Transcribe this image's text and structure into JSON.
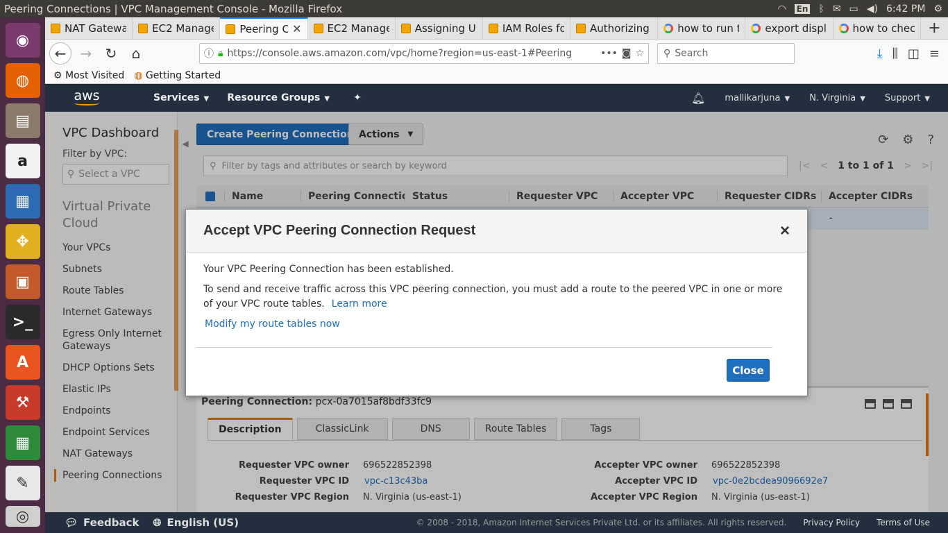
{
  "os": {
    "window_title": "Peering Connections | VPC Management Console - Mozilla Firefox",
    "keyboard": "En",
    "clock": "6:42 PM"
  },
  "browser": {
    "tabs": [
      {
        "label": "NAT Gatewa",
        "icon": "aws-icon"
      },
      {
        "label": "EC2 Manage",
        "icon": "aws-icon"
      },
      {
        "label": "Peering C",
        "icon": "aws-icon",
        "active": true
      },
      {
        "label": "EC2 Manage",
        "icon": "aws-icon"
      },
      {
        "label": "Assigning U",
        "icon": "aws-icon"
      },
      {
        "label": "IAM Roles fo",
        "icon": "aws-icon"
      },
      {
        "label": "Authorizing",
        "icon": "aws-icon"
      },
      {
        "label": "how to run t",
        "icon": "google-icon"
      },
      {
        "label": "export displ",
        "icon": "google-icon"
      },
      {
        "label": "how to chec",
        "icon": "google-icon"
      }
    ],
    "url": "https://console.aws.amazon.com/vpc/home?region=us-east-1#Peering",
    "search_placeholder": "Search",
    "bookmarks": [
      "Most Visited",
      "Getting Started"
    ]
  },
  "aws_nav": {
    "logo": "aws",
    "services": "Services",
    "resource_groups": "Resource Groups",
    "user": "mallikarjuna",
    "region": "N. Virginia",
    "support": "Support"
  },
  "sidebar": {
    "dashboard": "VPC Dashboard",
    "filter_label": "Filter by VPC:",
    "filter_placeholder": "Select a VPC",
    "section": "Virtual Private Cloud",
    "items": [
      "Your VPCs",
      "Subnets",
      "Route Tables",
      "Internet Gateways",
      "Egress Only Internet Gateways",
      "DHCP Options Sets",
      "Elastic IPs",
      "Endpoints",
      "Endpoint Services",
      "NAT Gateways",
      "Peering Connections"
    ]
  },
  "toolbar": {
    "create": "Create Peering Connection",
    "actions": "Actions",
    "filter_placeholder": "Filter by tags and attributes or search by keyword",
    "pager": "1 to 1 of 1"
  },
  "grid": {
    "columns": [
      "Name",
      "Peering Connectic",
      "Status",
      "Requester VPC",
      "Accepter VPC",
      "Requester CIDRs",
      "Accepter CIDRs"
    ],
    "row_accepter_cidrs": "-"
  },
  "detail": {
    "label": "Peering Connection:",
    "id": "pcx-0a7015af8bdf33fc9",
    "tabs": [
      "Description",
      "ClassicLink",
      "DNS",
      "Route Tables",
      "Tags"
    ],
    "requester_owner_label": "Requester VPC owner",
    "requester_owner": "696522852398",
    "requester_id_label": "Requester VPC ID",
    "requester_id": "vpc-c13c43ba",
    "requester_region_label": "Requester VPC Region",
    "requester_region": "N. Virginia (us-east-1)",
    "accepter_owner_label": "Accepter VPC owner",
    "accepter_owner": "696522852398",
    "accepter_id_label": "Accepter VPC ID",
    "accepter_id": "vpc-0e2bcdea9096692e7",
    "accepter_region_label": "Accepter VPC Region",
    "accepter_region": "N. Virginia (us-east-1)"
  },
  "modal": {
    "title": "Accept VPC Peering Connection Request",
    "close_x": "×",
    "line1": "Your VPC Peering Connection has been established.",
    "line2": "To send and receive traffic across this VPC peering connection, you must add a route to the peered VPC in one or more of your VPC route tables.",
    "learn_more": "Learn more",
    "modify_link": "Modify my route tables now",
    "close_button": "Close"
  },
  "footer": {
    "feedback": "Feedback",
    "language": "English (US)",
    "copyright": "© 2008 - 2018, Amazon Internet Services Private Ltd. or its affiliates. All rights reserved.",
    "privacy": "Privacy Policy",
    "terms": "Terms of Use"
  },
  "colors": {
    "aws_nav": "#232f3e",
    "primary_button": "#1f6fbe",
    "accent": "#e47911",
    "launcher": "#4c2c45"
  }
}
